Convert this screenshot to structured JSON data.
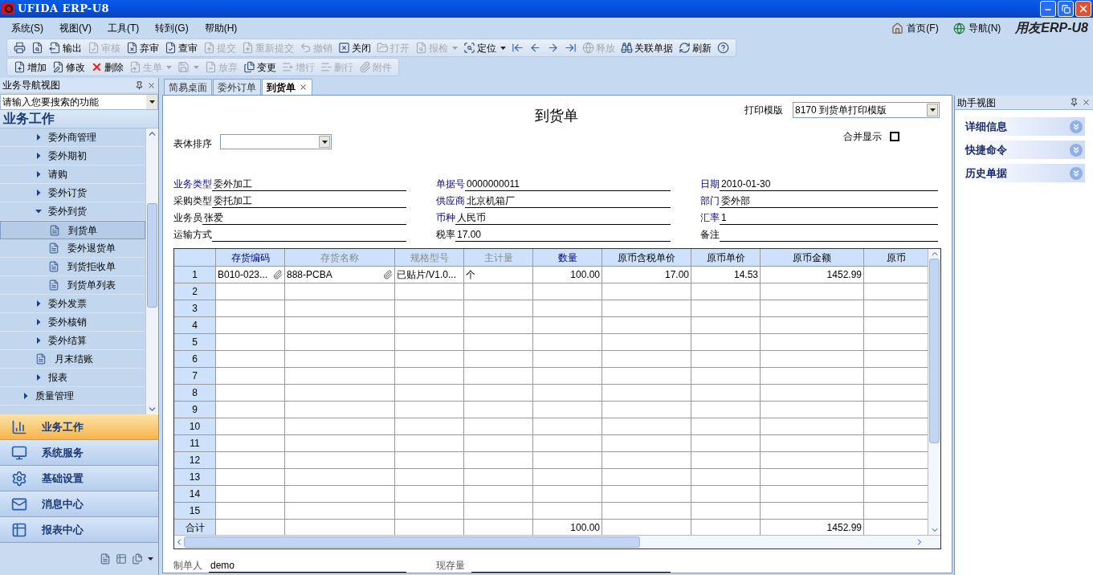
{
  "window": {
    "title": "UFIDA ERP-U8"
  },
  "menu": [
    "系统(S)",
    "视图(V)",
    "工具(T)",
    "转到(G)",
    "帮助(H)"
  ],
  "top_links": [
    "首页(F)",
    "导航(N)"
  ],
  "brand": "用友ERP-U8",
  "toolbar_1": [
    {
      "kind": "icon",
      "disabled": false
    },
    {
      "kind": "icon",
      "disabled": false
    },
    {
      "kind": "button",
      "label": "输出",
      "disabled": false
    },
    {
      "kind": "button",
      "label": "审核",
      "disabled": true
    },
    {
      "kind": "button",
      "label": "弃审",
      "disabled": false
    },
    {
      "kind": "button",
      "label": "查审",
      "disabled": false
    },
    {
      "kind": "button",
      "label": "提交",
      "disabled": true
    },
    {
      "kind": "button",
      "label": "重新提交",
      "disabled": true
    },
    {
      "kind": "button",
      "label": "撤销",
      "disabled": true
    },
    {
      "kind": "button",
      "label": "关闭",
      "disabled": false
    },
    {
      "kind": "button",
      "label": "打开",
      "disabled": true
    },
    {
      "kind": "button",
      "label": "报检",
      "disabled": true,
      "dropdown": true
    },
    {
      "kind": "button",
      "label": "定位",
      "disabled": false,
      "dropdown": true
    },
    {
      "kind": "icon",
      "disabled": false
    },
    {
      "kind": "icon",
      "disabled": false
    },
    {
      "kind": "icon",
      "disabled": false
    },
    {
      "kind": "icon",
      "disabled": false
    },
    {
      "kind": "button",
      "label": "释放",
      "disabled": true
    },
    {
      "kind": "button",
      "label": "关联单据",
      "disabled": false
    },
    {
      "kind": "button",
      "label": "刷新",
      "disabled": false
    },
    {
      "kind": "icon",
      "disabled": false
    }
  ],
  "toolbar_2": [
    {
      "kind": "button",
      "label": "增加",
      "disabled": false
    },
    {
      "kind": "button",
      "label": "修改",
      "disabled": false
    },
    {
      "kind": "button",
      "label": "删除",
      "disabled": false
    },
    {
      "kind": "button",
      "label": "生单",
      "disabled": true,
      "dropdown": true
    },
    {
      "kind": "icon",
      "disabled": true,
      "dropdown": true
    },
    {
      "kind": "button",
      "label": "放弃",
      "disabled": true
    },
    {
      "kind": "button",
      "label": "变更",
      "disabled": false
    },
    {
      "kind": "button",
      "label": "增行",
      "disabled": true
    },
    {
      "kind": "button",
      "label": "删行",
      "disabled": true
    },
    {
      "kind": "button",
      "label": "附件",
      "disabled": true
    }
  ],
  "nav_panel": {
    "title": "业务导航视图",
    "placeholder": "请输入您要搜索的功能",
    "section": "业务工作",
    "tree": [
      {
        "children": [
          {
            "kind": "folder",
            "label": "委外商管理",
            "expanded": false,
            "selected": false
          },
          {
            "kind": "folder",
            "label": "委外期初",
            "expanded": false,
            "selected": false
          },
          {
            "kind": "folder",
            "label": "请购",
            "expanded": false,
            "selected": false
          },
          {
            "kind": "folder",
            "label": "委外订货",
            "expanded": false,
            "selected": false
          },
          {
            "kind": "folder",
            "label": "委外到货",
            "expanded": true,
            "selected": false,
            "children": [
              {
                "kind": "doc",
                "label": "到货单",
                "selected": true
              },
              {
                "kind": "doc",
                "label": "委外退货单",
                "selected": false
              },
              {
                "kind": "doc",
                "label": "到货拒收单",
                "selected": false
              },
              {
                "kind": "doc",
                "label": "到货单列表",
                "selected": false
              }
            ]
          },
          {
            "kind": "folder",
            "label": "委外发票",
            "expanded": false,
            "selected": false
          },
          {
            "kind": "folder",
            "label": "委外核销",
            "expanded": false,
            "selected": false
          },
          {
            "kind": "folder",
            "label": "委外结算",
            "expanded": false,
            "selected": false
          },
          {
            "kind": "doc",
            "label": "月末结账",
            "selected": false
          },
          {
            "kind": "folder",
            "label": "报表",
            "expanded": false,
            "selected": false
          }
        ]
      },
      {
        "kind": "folder",
        "label": "质量管理",
        "expanded": false,
        "selected": false
      }
    ]
  },
  "outlook": [
    {
      "label": "业务工作",
      "selected": true
    },
    {
      "label": "系统服务",
      "selected": false
    },
    {
      "label": "基础设置",
      "selected": false
    },
    {
      "label": "消息中心",
      "selected": false
    },
    {
      "label": "报表中心",
      "selected": false
    }
  ],
  "tabs": [
    {
      "label": "简易桌面",
      "selected": false
    },
    {
      "label": "委外订单",
      "selected": false
    },
    {
      "label": "到货单",
      "selected": true
    }
  ],
  "document": {
    "title": "到货单",
    "print_template": {
      "label": "打印模版",
      "value": "8170 到货单打印模版"
    },
    "sort": {
      "label": "表体排序"
    },
    "merge": {
      "label": "合并显示",
      "checked": false
    },
    "fields": [
      {
        "label": "业务类型",
        "value": "委外加工",
        "required": true
      },
      {
        "label": "单据号",
        "value": "0000000011",
        "required": true
      },
      {
        "label": "日期",
        "value": "2010-01-30",
        "required": true
      },
      {
        "label": "采购类型",
        "value": "委托加工",
        "required": false
      },
      {
        "label": "供应商",
        "value": "北京机箱厂",
        "required": true
      },
      {
        "label": "部门",
        "value": "委外部",
        "required": true
      },
      {
        "label": "业务员",
        "value": "张爱",
        "required": false
      },
      {
        "label": "币种",
        "value": "人民币",
        "required": true
      },
      {
        "label": "汇率",
        "value": "1",
        "required": true
      },
      {
        "label": "运输方式",
        "required": false
      },
      {
        "label": "税率",
        "value": "17.00",
        "required": false
      },
      {
        "label": "备注",
        "required": false
      }
    ],
    "table": {
      "columns": [
        {
          "label": "存货编码"
        },
        {
          "label": "存货名称"
        },
        {
          "label": "规格型号"
        },
        {
          "label": "主计量"
        },
        {
          "label": "数量"
        },
        {
          "label": "原币含税单价"
        },
        {
          "label": "原币单价"
        },
        {
          "label": "原币金额"
        },
        {
          "label": "原币"
        }
      ],
      "rows": [
        {
          "number": "1",
          "cells": [
            "B010-023...",
            "888-PCBA",
            "已贴片/V1.0...",
            "个",
            "100.00",
            "17.00",
            "14.53",
            "1452.99",
            null
          ]
        },
        {
          "number": "2"
        },
        {
          "number": "3"
        },
        {
          "number": "4"
        },
        {
          "number": "5"
        },
        {
          "number": "6"
        },
        {
          "number": "7"
        },
        {
          "number": "8"
        },
        {
          "number": "9"
        },
        {
          "number": "10"
        },
        {
          "number": "11"
        },
        {
          "number": "12"
        },
        {
          "number": "13"
        },
        {
          "number": "14"
        },
        {
          "number": "15"
        }
      ],
      "totals": {
        "label": "合计",
        "cells": [
          null,
          null,
          null,
          null,
          "100.00",
          null,
          null,
          "1452.99",
          null
        ]
      }
    },
    "footer": [
      {
        "label": "制单人",
        "value": "demo"
      },
      {
        "label": "现存量"
      }
    ]
  },
  "assistant": {
    "title": "助手视图",
    "sections": [
      "详细信息",
      "快捷命令",
      "历史单据"
    ]
  }
}
